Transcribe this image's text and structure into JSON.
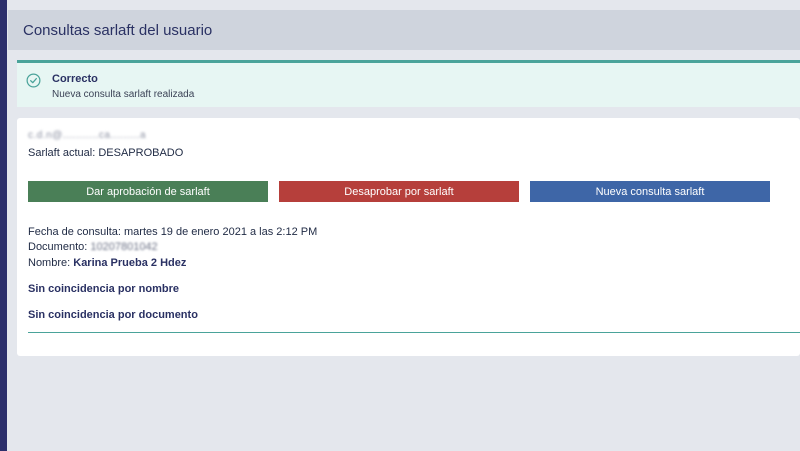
{
  "header": {
    "title": "Consultas sarlaft del usuario"
  },
  "alert": {
    "icon": "check-circle-icon",
    "title": "Correcto",
    "message": "Nueva consulta sarlaft realizada"
  },
  "user": {
    "email_redacted": "c.d.n@...........ca.........a",
    "sarlaft_label": "Sarlaft actual:",
    "sarlaft_status": "DESAPROBADO"
  },
  "actions": {
    "approve": "Dar aprobación de sarlaft",
    "reject": "Desaprobar por sarlaft",
    "new_query": "Nueva consulta sarlaft"
  },
  "details": {
    "fecha_label": "Fecha de consulta:",
    "fecha_value": "martes 19 de enero 2021 a las 2:12 PM",
    "documento_label": "Documento:",
    "documento_value": "10207801042",
    "nombre_label": "Nombre:",
    "nombre_value": "Karina Prueba 2 Hdez",
    "nombre_result": "Sin coincidencia por nombre",
    "documento_result": "Sin coincidencia por documento"
  },
  "colors": {
    "approve": "#4a7f57",
    "reject": "#b63f3b",
    "new_query": "#3e66a7",
    "success_accent": "#4aa39a"
  }
}
